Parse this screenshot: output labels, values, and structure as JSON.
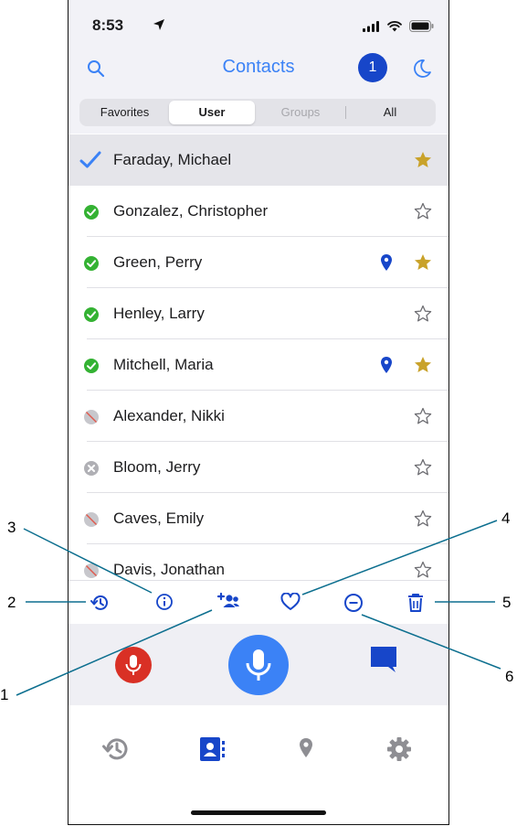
{
  "status": {
    "time": "8:53"
  },
  "header": {
    "title": "Contacts",
    "badge": "1"
  },
  "segments": [
    {
      "label": "Favorites",
      "state": "normal"
    },
    {
      "label": "User",
      "state": "selected"
    },
    {
      "label": "Groups",
      "state": "disabled"
    },
    {
      "label": "All",
      "state": "normal"
    }
  ],
  "contacts": [
    {
      "name": "Faraday, Michael",
      "status": "selected",
      "location": false,
      "favorite": true
    },
    {
      "name": "Gonzalez, Christopher",
      "status": "online",
      "location": false,
      "favorite": false
    },
    {
      "name": "Green, Perry",
      "status": "online",
      "location": true,
      "favorite": true
    },
    {
      "name": "Henley, Larry",
      "status": "online",
      "location": false,
      "favorite": false
    },
    {
      "name": "Mitchell, Maria",
      "status": "online",
      "location": true,
      "favorite": true
    },
    {
      "name": "Alexander, Nikki",
      "status": "offline",
      "location": false,
      "favorite": false
    },
    {
      "name": "Bloom, Jerry",
      "status": "unavailable",
      "location": false,
      "favorite": false
    },
    {
      "name": "Caves, Emily",
      "status": "offline",
      "location": false,
      "favorite": false
    },
    {
      "name": "Davis, Jonathan",
      "status": "offline",
      "location": false,
      "favorite": false
    }
  ],
  "callouts": [
    "1",
    "2",
    "3",
    "4",
    "5",
    "6"
  ],
  "colors": {
    "accent": "#3b82f6",
    "badge": "#1746c9",
    "online": "#34b233",
    "favorite": "#c9a22a",
    "mic_red": "#d93025"
  },
  "icons": {
    "action_bar": [
      "history-icon",
      "info-icon",
      "add-group-icon",
      "heart-icon",
      "minus-circle-icon",
      "trash-icon"
    ],
    "tab_bar": [
      "history-icon",
      "contacts-icon",
      "location-icon",
      "settings-icon"
    ]
  }
}
